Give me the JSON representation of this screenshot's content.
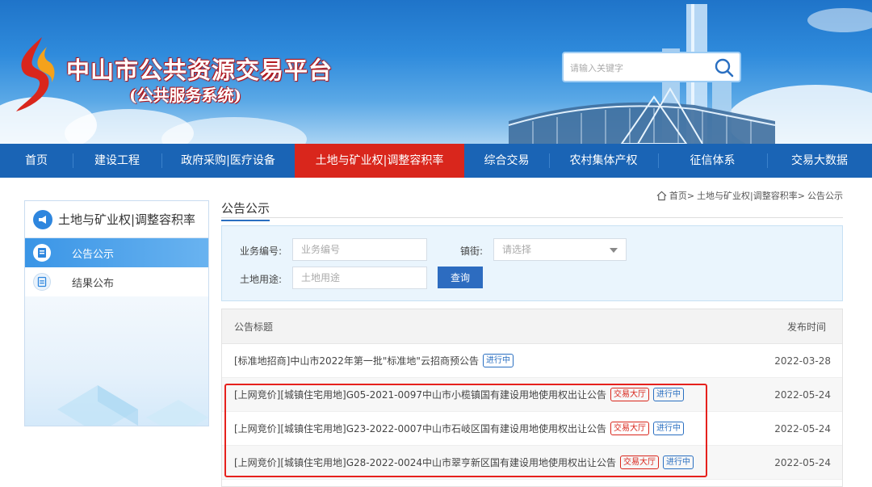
{
  "header": {
    "title": "中山市公共资源交易平台",
    "subtitle": "(公共服务系统)",
    "search_placeholder": "请输入关键字"
  },
  "nav": {
    "items": [
      {
        "label": "首页",
        "active": false
      },
      {
        "label": "建设工程",
        "active": false
      },
      {
        "label": "政府采购|医疗设备",
        "active": false
      },
      {
        "label": "土地与矿业权|调整容积率",
        "active": true
      },
      {
        "label": "综合交易",
        "active": false
      },
      {
        "label": "农村集体产权",
        "active": false
      },
      {
        "label": "征信体系",
        "active": false
      },
      {
        "label": "交易大数据",
        "active": false
      }
    ]
  },
  "sidebar": {
    "title": "土地与矿业权|调整容积率",
    "items": [
      {
        "label": "公告公示",
        "active": true
      },
      {
        "label": "结果公布",
        "active": false
      }
    ]
  },
  "breadcrumb": {
    "home": "首页",
    "sep": ">",
    "level1": "土地与矿业权|调整容积率",
    "level2": "公告公示"
  },
  "main": {
    "title": "公告公示"
  },
  "filter": {
    "code_label": "业务编号:",
    "code_placeholder": "业务编号",
    "town_label": "镇街:",
    "town_placeholder": "请选择",
    "use_label": "土地用途:",
    "use_placeholder": "土地用途",
    "query_label": "查询"
  },
  "table": {
    "col_title": "公告标题",
    "col_date": "发布时间",
    "rows": [
      {
        "title": "[标准地招商]中山市2022年第一批\"标准地\"云招商预公告",
        "tag_hall": "",
        "tag_status": "进行中",
        "date": "2022-03-28"
      },
      {
        "title": "[上网竞价][城镇住宅用地]G05-2021-0097中山市小榄镇国有建设用地使用权出让公告",
        "tag_hall": "交易大厅",
        "tag_status": "进行中",
        "date": "2022-05-24"
      },
      {
        "title": "[上网竞价][城镇住宅用地]G23-2022-0007中山市石岐区国有建设用地使用权出让公告",
        "tag_hall": "交易大厅",
        "tag_status": "进行中",
        "date": "2022-05-24"
      },
      {
        "title": "[上网竞价][城镇住宅用地]G28-2022-0024中山市翠亨新区国有建设用地使用权出让公告",
        "tag_hall": "交易大厅",
        "tag_status": "进行中",
        "date": "2022-05-24"
      }
    ]
  },
  "colors": {
    "nav_bg": "#1a64b5",
    "nav_active": "#d9261c",
    "accent_blue": "#2a6fc1",
    "highlight": "#e6211d"
  }
}
